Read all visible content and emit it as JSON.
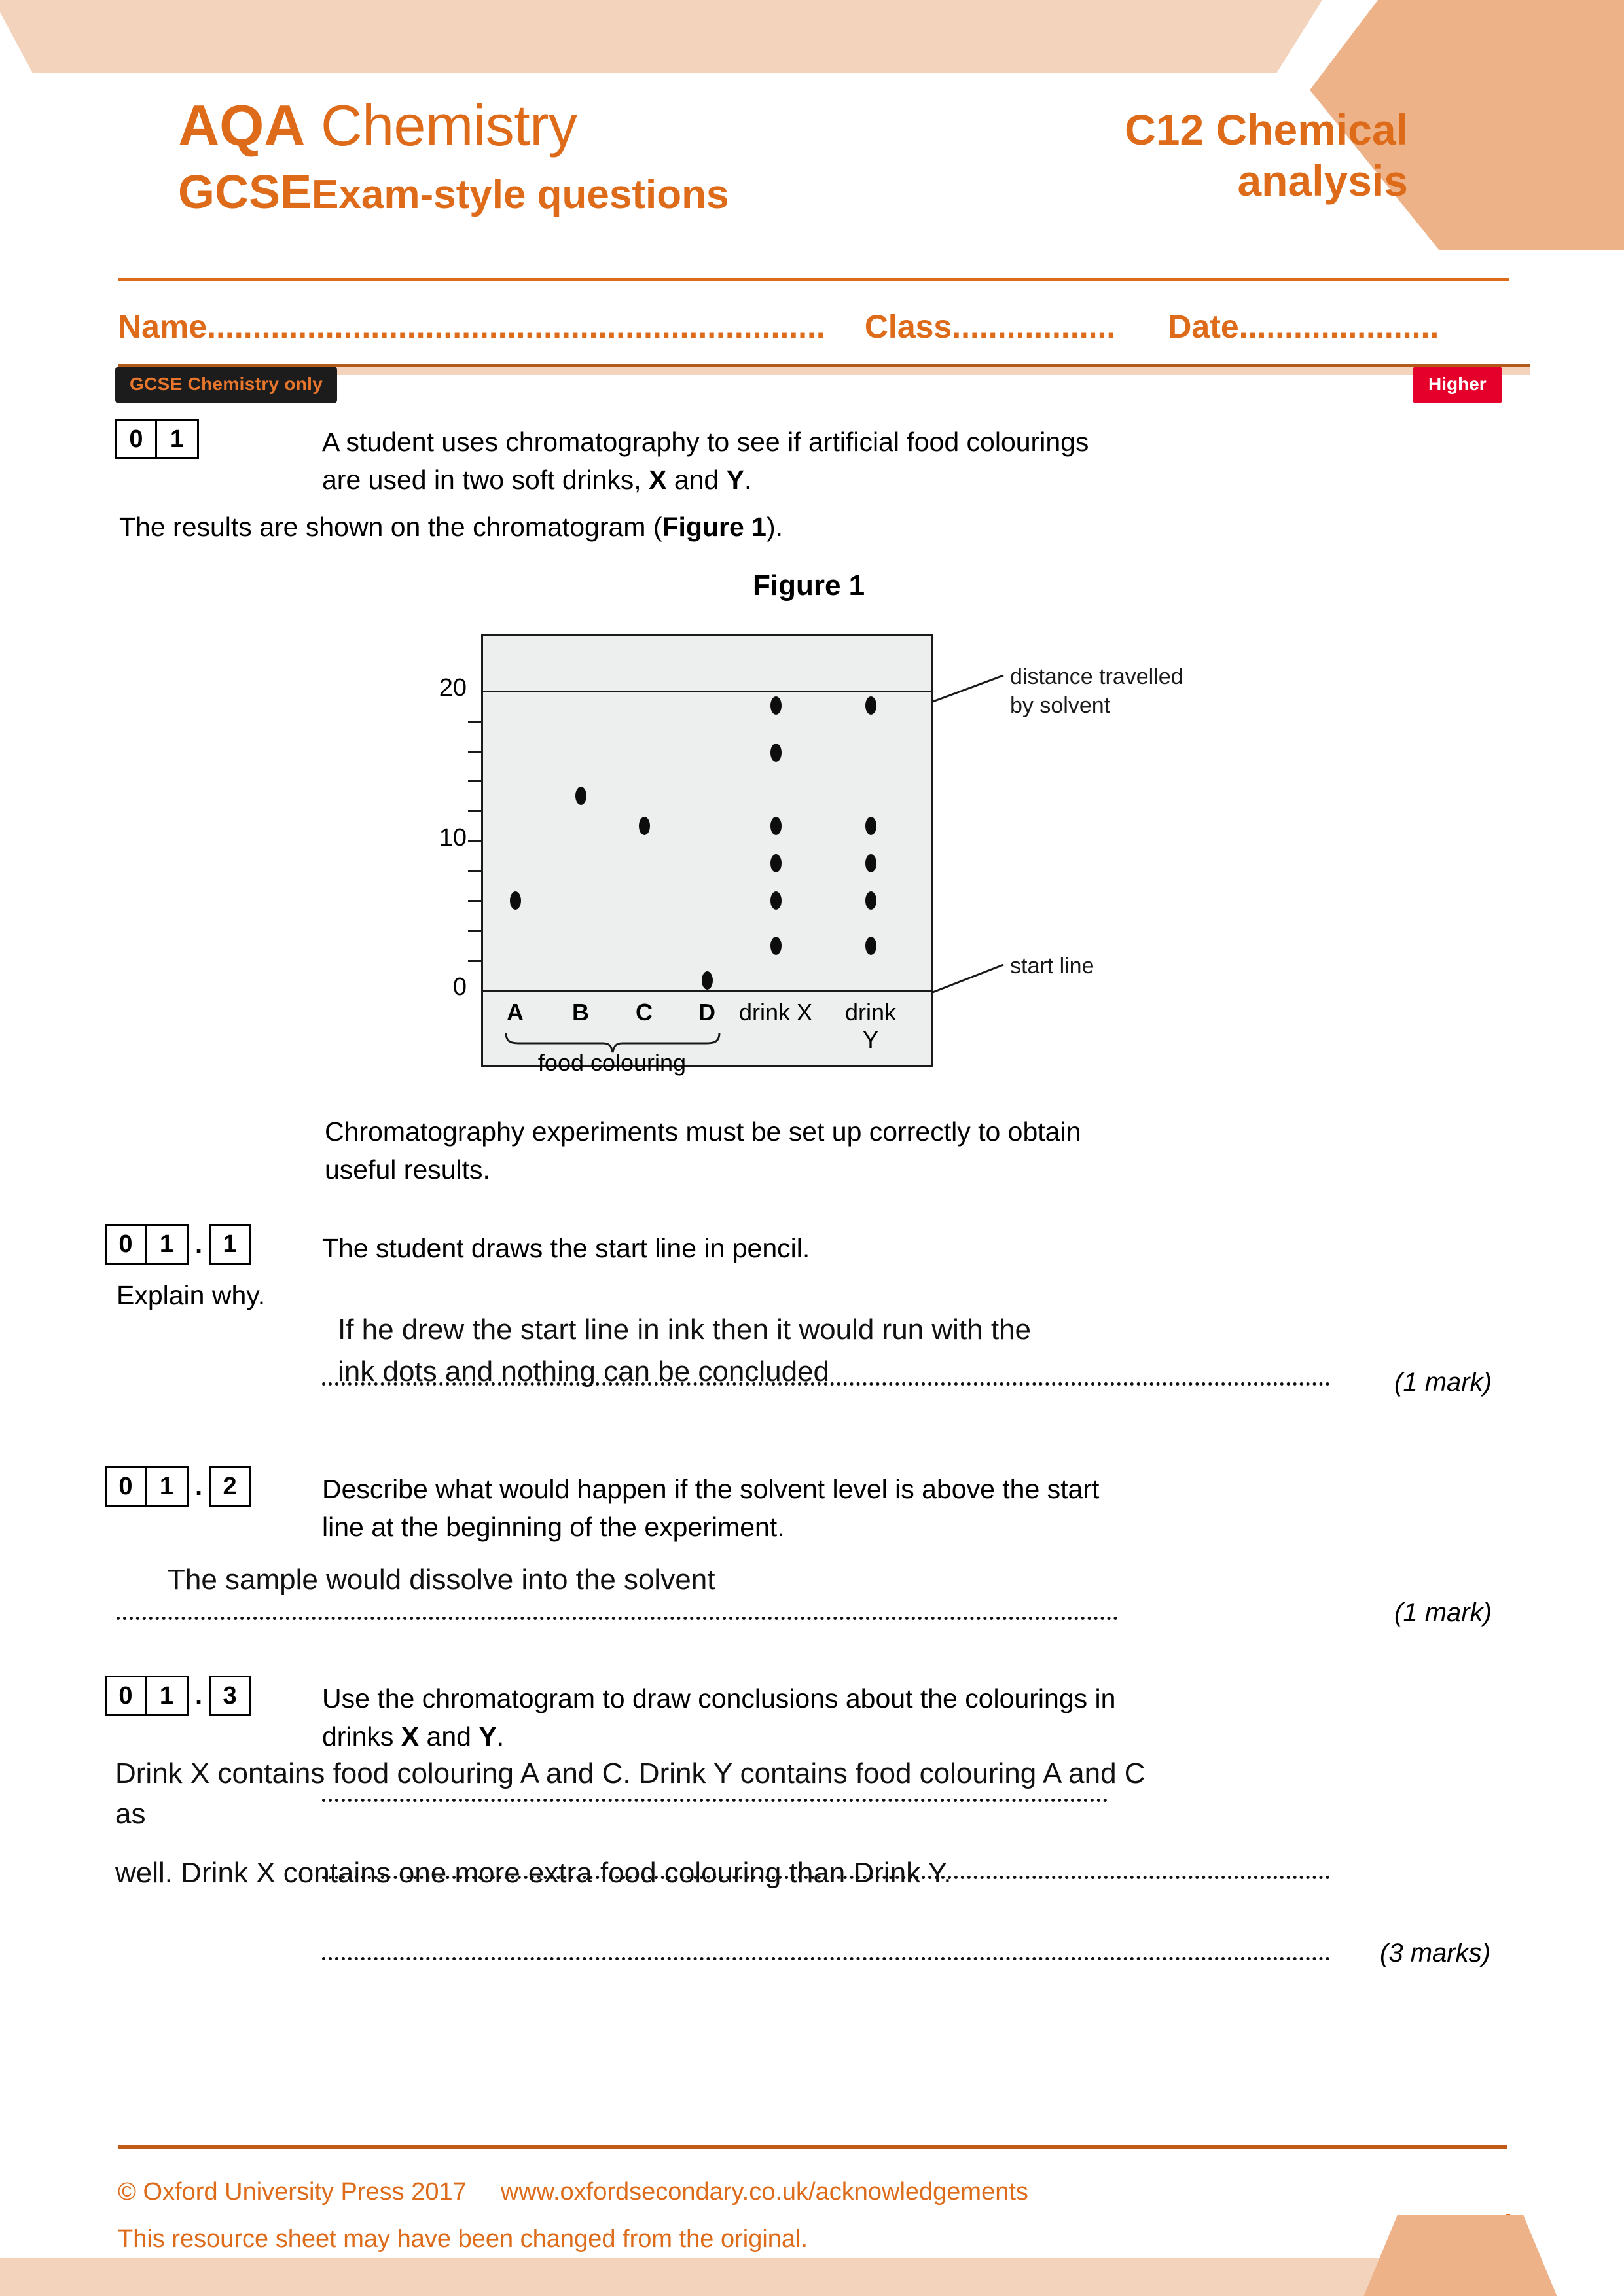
{
  "brand": {
    "awarding_body": "AQA",
    "subject": "Chemistry",
    "qualification": "GCSE",
    "resource_type": "Exam-style questions",
    "topic_title_line1": "C12 Chemical",
    "topic_title_line2": "analysis",
    "accent_color": "#DD6B1A",
    "band_light": "#F4D3BC",
    "band_dark": "#EDB288"
  },
  "fields": {
    "name_label": "Name....................................................................",
    "class_label": "Class..................",
    "date_label": "Date......................"
  },
  "badges": {
    "tier_only": "GCSE Chemistry only",
    "tier_level": "Higher",
    "tier_only_bg": "#1C1C1C",
    "tier_only_fg": "#E8762C",
    "tier_level_bg": "#E4002B",
    "tier_level_fg": "#FFFFFF"
  },
  "question": {
    "number_digits": [
      "0",
      "1"
    ],
    "stem_line1": "A student uses chromatography to see if artificial food colourings",
    "stem_line2_a": "are used in two soft drinks, ",
    "stem_line2_x": "X",
    "stem_line2_and": " and ",
    "stem_line2_y": "Y",
    "stem_line2_end": ".",
    "results_line_a": "The results are shown on the chromatogram (",
    "results_line_fig": "Figure 1",
    "results_line_end": ").",
    "setup_line1": "Chromatography experiments must be set up correctly to obtain",
    "setup_line2": "useful results."
  },
  "figure": {
    "title": "Figure 1",
    "callout_solvent_line1": "distance travelled",
    "callout_solvent_line2": "by solvent",
    "callout_start": "start line",
    "brace_label": "food colouring"
  },
  "chart_data": {
    "type": "scatter",
    "title": "Figure 1",
    "ylabel": "",
    "xlabel": "",
    "ylim": [
      0,
      24
    ],
    "ytick_labels": [
      "0",
      "10",
      "20"
    ],
    "ytick_values": [
      0,
      10,
      20
    ],
    "minor_tick_values": [
      2,
      4,
      6,
      8,
      12,
      14,
      16,
      18
    ],
    "grid": false,
    "reference_lines": [
      {
        "name": "start line",
        "value": 0
      },
      {
        "name": "distance travelled by solvent",
        "value": 20
      }
    ],
    "categories": [
      "A",
      "B",
      "C",
      "D",
      "drink X",
      "drink Y"
    ],
    "series": [
      {
        "name": "A",
        "values": [
          6.0
        ]
      },
      {
        "name": "B",
        "values": [
          13.0
        ]
      },
      {
        "name": "C",
        "values": [
          11.0
        ]
      },
      {
        "name": "D",
        "values": [
          0.7
        ]
      },
      {
        "name": "drink X",
        "values": [
          19.6,
          16.4,
          11.0,
          8.5,
          6.0,
          3.0
        ]
      },
      {
        "name": "drink Y",
        "values": [
          19.6,
          11.0,
          8.5,
          6.0,
          3.0
        ]
      }
    ]
  },
  "sub_questions": [
    {
      "digits": [
        "0",
        "1"
      ],
      "sub": "1",
      "prompt_line1": "The student draws the start line in pencil.",
      "prompt_line2": "Explain why.",
      "answer_line1": "If he drew the start line in ink then it would run with the",
      "answer_line2": "ink dots and nothing can be concluded",
      "marks": "(1 mark)",
      "marks_num": "1",
      "marks_word": "mark"
    },
    {
      "digits": [
        "0",
        "1"
      ],
      "sub": "2",
      "prompt_line1": "Describe what would happen if the solvent level is above the start",
      "prompt_line2": "line at the beginning of the experiment.",
      "answer_line1": "The sample would dissolve into the solvent",
      "marks": "(1 mark)",
      "marks_num": "1",
      "marks_word": "mark"
    },
    {
      "digits": [
        "0",
        "1"
      ],
      "sub": "3",
      "prompt_line1": "Use the chromatogram to draw conclusions about the colourings in",
      "prompt_line2_a": "drinks ",
      "prompt_line2_x": "X",
      "prompt_line2_and": " and ",
      "prompt_line2_y": "Y",
      "prompt_line2_end": ".",
      "answer_line1": "Drink X contains food colouring A and C. Drink Y contains food colouring A and C",
      "answer_line2": "as",
      "answer_line3": "well. Drink X contains one more extra food colouring than Drink Y.",
      "marks": "(3 marks)",
      "marks_num": "3",
      "marks_word": "marks"
    }
  ],
  "footer": {
    "copyright": "© Oxford University Press 2017",
    "url": "www.oxfordsecondary.co.uk/acknowledgements",
    "note": "This resource sheet may have been changed from the original.",
    "page_number": "1"
  }
}
